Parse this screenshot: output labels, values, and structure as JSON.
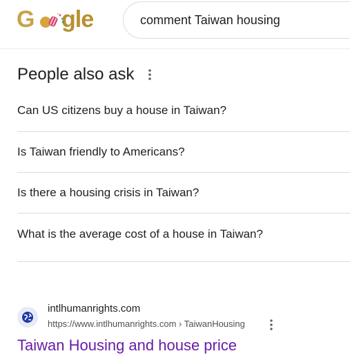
{
  "header": {
    "logo_text": "Google",
    "search_query": "comment Taiwan housing"
  },
  "paa": {
    "title": "People also ask",
    "questions": [
      "Can US citizens buy a house in Taiwan?",
      "Is Taiwan friendly to Americans?",
      "Is there a housing crisis in Taiwan?",
      "What is the average cost of a house in Taiwan?"
    ]
  },
  "result": {
    "site_name": "intlhumanrights.com",
    "url": "https://www.intlhumanrights.com › TaiwanHousing",
    "title": "Taiwan Housing and house price"
  },
  "colors": {
    "link_visited": "#681da8",
    "divider": "#dadce0",
    "logo_gold": "#c8a24a",
    "globe_blue": "#1a3aa8"
  },
  "icons": [
    "google-doodle-logo",
    "more-vert-icon",
    "globe-icon"
  ]
}
